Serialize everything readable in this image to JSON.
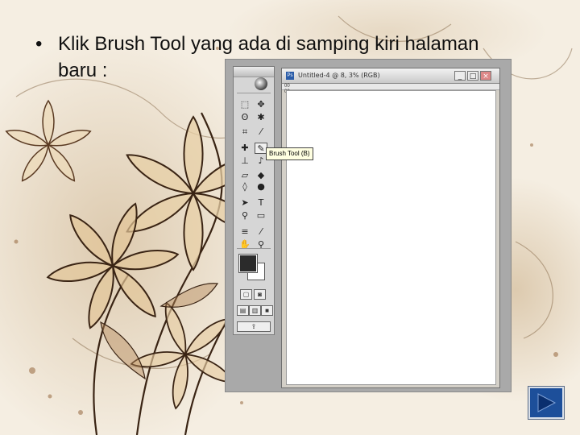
{
  "slide": {
    "bullet_symbol": "•",
    "bullet_text": "Klik Brush Tool yang ada di samping kiri halaman baru :"
  },
  "photoshop": {
    "document_title": "Untitled-4 @ 8, 3% (RGB)",
    "ruler_corner_label": "00 00",
    "window_buttons": {
      "minimize": "_",
      "maximize": "□",
      "close": "×"
    },
    "tooltip_text": "Brush Tool (B)",
    "selected_tool": "brush-tool",
    "foreground_color": "#2b2b2b",
    "background_color": "#ffffff",
    "tools": [
      {
        "name": "marquee-tool",
        "glyph": "⬚"
      },
      {
        "name": "move-tool",
        "glyph": "✥"
      },
      {
        "name": "lasso-tool",
        "glyph": "ʘ"
      },
      {
        "name": "magic-wand-tool",
        "glyph": "✱"
      },
      {
        "name": "crop-tool",
        "glyph": "⌗"
      },
      {
        "name": "slice-tool",
        "glyph": "⁄"
      },
      {
        "name": "healing-brush-tool",
        "glyph": "✚"
      },
      {
        "name": "brush-tool",
        "glyph": "✎"
      },
      {
        "name": "clone-stamp-tool",
        "glyph": "⊥"
      },
      {
        "name": "history-brush-tool",
        "glyph": "♪"
      },
      {
        "name": "eraser-tool",
        "glyph": "▱"
      },
      {
        "name": "paint-bucket-tool",
        "glyph": "◆"
      },
      {
        "name": "blur-tool",
        "glyph": "◊"
      },
      {
        "name": "dodge-tool",
        "glyph": "●"
      },
      {
        "name": "path-selection-tool",
        "glyph": "➤"
      },
      {
        "name": "type-tool",
        "glyph": "T"
      },
      {
        "name": "pen-tool",
        "glyph": "⚲"
      },
      {
        "name": "shape-tool",
        "glyph": "▭"
      },
      {
        "name": "notes-tool",
        "glyph": "≡"
      },
      {
        "name": "eyedropper-tool",
        "glyph": "⁄"
      },
      {
        "name": "hand-tool",
        "glyph": "✋"
      },
      {
        "name": "zoom-tool",
        "glyph": "⚲"
      }
    ]
  },
  "navigation": {
    "next_button_icon": "play-next-icon",
    "accent_color": "#1d4f9a"
  }
}
